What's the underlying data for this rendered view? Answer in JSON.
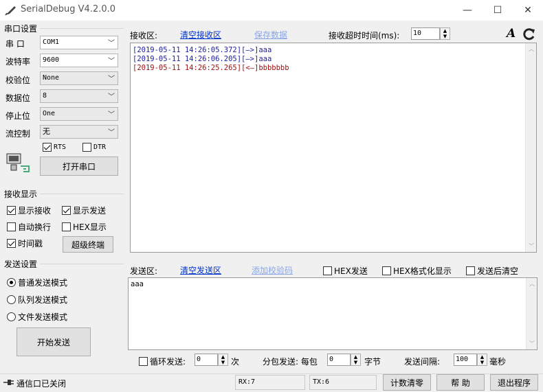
{
  "window": {
    "title": "SerialDebug V4.2.0.0",
    "minimize_glyph": "—",
    "maximize_glyph": "☐",
    "close_glyph": "✕"
  },
  "serial_settings": {
    "group_title": "串口设置",
    "port_label": "串  口",
    "port_value": "COM1",
    "baud_label": "波特率",
    "baud_value": "9600",
    "parity_label": "校验位",
    "parity_value": "None",
    "databits_label": "数据位",
    "databits_value": "8",
    "stopbits_label": "停止位",
    "stopbits_value": "One",
    "flow_label": "流控制",
    "flow_value": "无",
    "rts_label": "RTS",
    "rts_checked": true,
    "dtr_label": "DTR",
    "dtr_checked": false,
    "open_button": "打开串口"
  },
  "receive_display": {
    "group_title": "接收显示",
    "show_receive": "显示接收",
    "show_send": "显示发送",
    "auto_wrap": "自动换行",
    "hex_display": "HEX显示",
    "timestamp": "时间戳",
    "super_terminal": "超级终端"
  },
  "send_settings": {
    "group_title": "发送设置",
    "mode_normal": "普通发送模式",
    "mode_queue": "队列发送模式",
    "mode_file": "文件发送模式",
    "start_button": "开始发送"
  },
  "receive_area": {
    "label": "接收区:",
    "clear_link": "清空接收区",
    "save_link": "保存数据",
    "timeout_label": "接收超时时间(ms):",
    "timeout_value": "10",
    "font_icon_text": "A",
    "log": [
      {
        "text": "[2019-05-11 14:26:05.372][—>]aaa",
        "color": "#1a1aa6"
      },
      {
        "text": "[2019-05-11 14:26:06.205][—>]aaa",
        "color": "#1a1aa6"
      },
      {
        "text": "[2019-05-11 14:26:25.265][<—]bbbbbbb",
        "color": "#a01010"
      }
    ]
  },
  "send_area": {
    "label": "发送区:",
    "clear_link": "清空发送区",
    "checksum_link": "添加校验码",
    "hex_send": "HEX发送",
    "hex_format": "HEX格式化显示",
    "clear_after_send": "发送后清空",
    "content": "aaa",
    "loop_send_label": "循环发送:",
    "loop_value": "0",
    "loop_unit": "次",
    "packet_label": "分包发送: 每包",
    "packet_value": "0",
    "packet_unit": "字节",
    "interval_label": "发送间隔:",
    "interval_value": "100",
    "interval_unit": "毫秒"
  },
  "status_bar": {
    "port_status": "通信口已关闭",
    "rx": "RX:7",
    "tx": "TX:6",
    "reset_counter": "计数清零",
    "help": "帮  助",
    "exit": "退出程序"
  }
}
